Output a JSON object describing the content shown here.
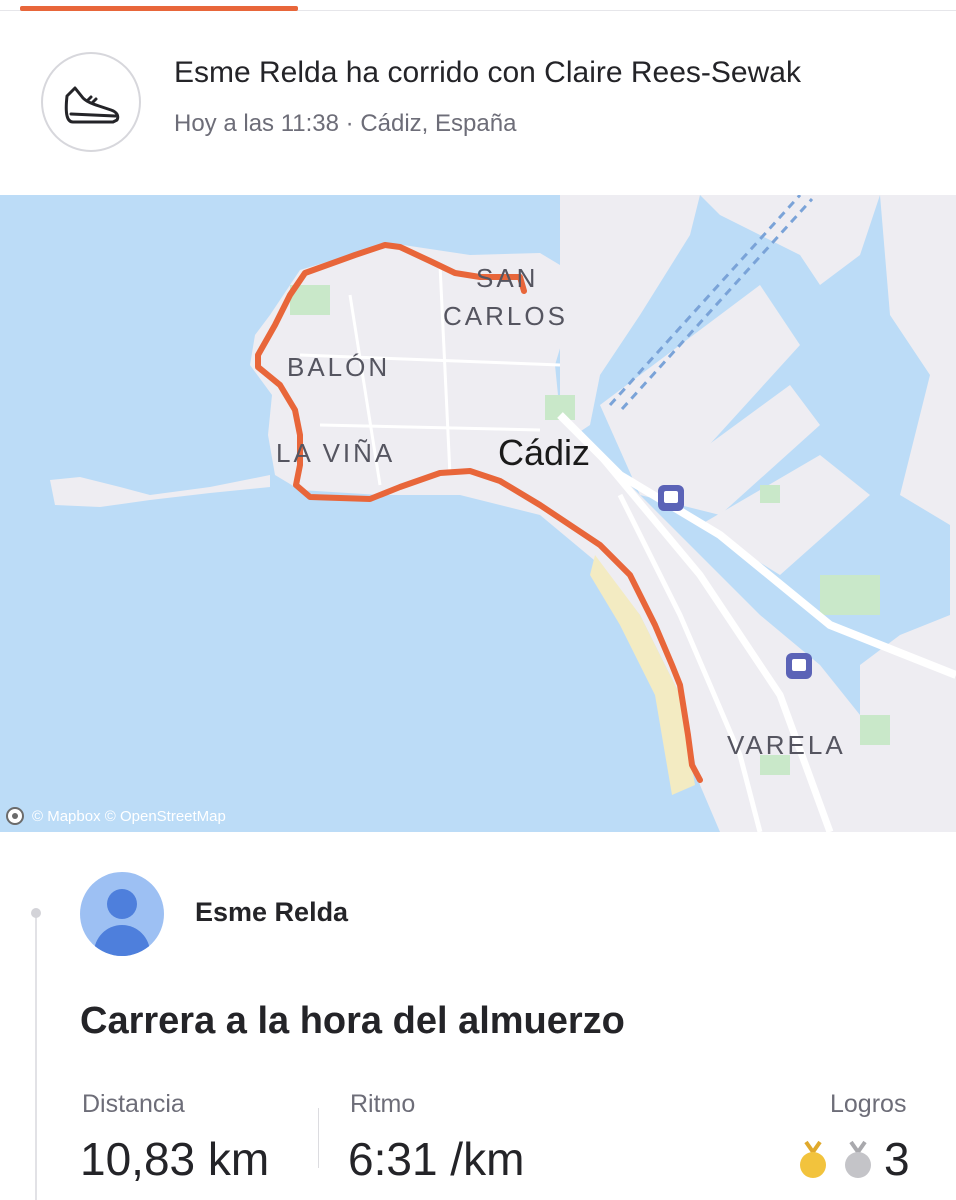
{
  "header": {
    "headline": "Esme Relda ha corrido con Claire Rees-Sewak",
    "subline": "Hoy a las 11:38 · Cádiz, España",
    "sport_icon": "running-shoe-icon"
  },
  "map": {
    "labels": {
      "san_carlos_1": "SAN",
      "san_carlos_2": "CARLOS",
      "balon": "BALÓN",
      "la_vina": "LA VIÑA",
      "city": "Cádiz",
      "varela": "VARELA"
    },
    "attribution": "© Mapbox © OpenStreetMap",
    "route_color": "#e8663a",
    "water_color": "#bcdcf7",
    "land_color": "#eeedf2"
  },
  "athlete": {
    "name": "Esme Relda",
    "avatar_icon": "default-avatar-icon"
  },
  "activity": {
    "title": "Carrera a la hora del almuerzo",
    "stats": {
      "distance_label": "Distancia",
      "distance_value": "10,83 km",
      "pace_label": "Ritmo",
      "pace_value": "6:31 /km",
      "achievements_label": "Logros",
      "achievements_count": "3",
      "medal_icons": [
        "gold-medal-icon",
        "silver-medal-icon"
      ]
    }
  }
}
